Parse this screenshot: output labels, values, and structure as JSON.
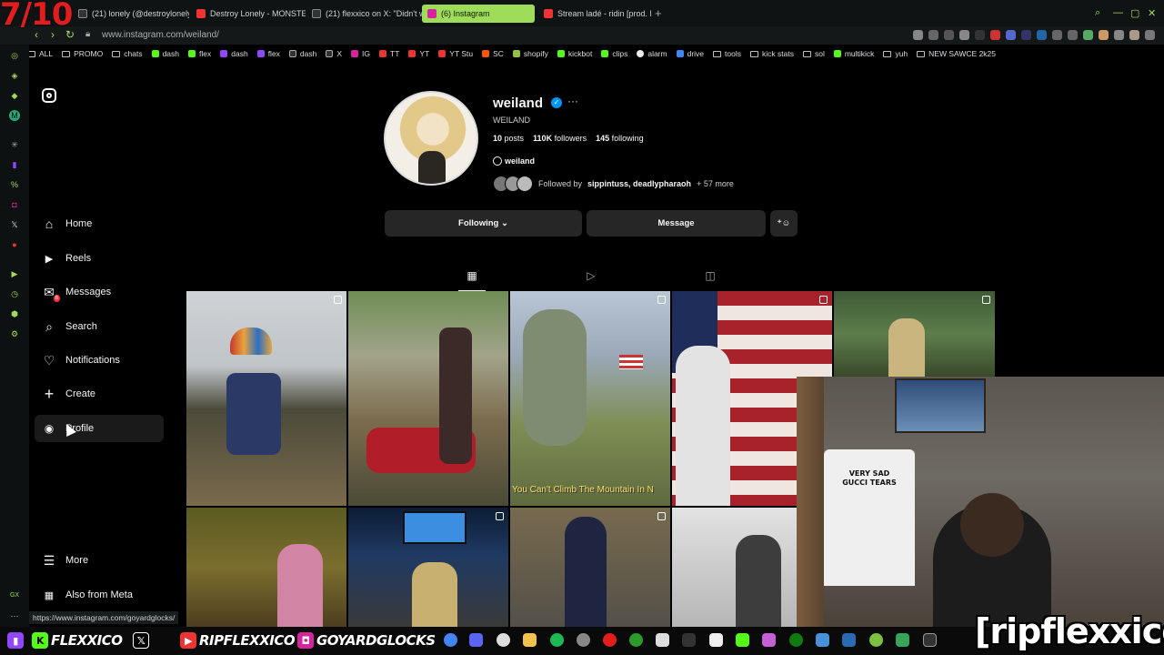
{
  "overlay": {
    "rating": "7/10",
    "watermark": "[ripflexxico]"
  },
  "browser": {
    "tabs": [
      {
        "label": "(21) lonely (@destroylonely",
        "color": "#444"
      },
      {
        "label": "Destroy Lonely - MONSTER",
        "color": "#e33"
      },
      {
        "label": "(21) flexxico on X: \"Didn't w",
        "color": "#444"
      },
      {
        "label": "(6) Instagram",
        "color": "#d6249f",
        "active": true
      },
      {
        "label": "Stream ladé - ridin [prod. h",
        "color": "#e33"
      }
    ],
    "url": "www.instagram.com/weiland/",
    "bookmarks": [
      "ALL",
      "PROMO",
      "chats",
      "dash",
      "flex",
      "dash",
      "flex",
      "dash",
      "X",
      "IG",
      "TT",
      "YT",
      "YT Stu",
      "SC",
      "shopify",
      "kickbot",
      "clips",
      "alarm",
      "drive",
      "tools",
      "kick stats",
      "sol",
      "multikick",
      "yuh",
      "NEW SAWCE 2k25"
    ],
    "status_url": "https://www.instagram.com/goyardglocks/"
  },
  "nav": {
    "items": [
      {
        "label": "Home",
        "icon": "home-icon",
        "glyph": "⌂"
      },
      {
        "label": "Reels",
        "icon": "reels-icon",
        "glyph": "▶"
      },
      {
        "label": "Messages",
        "icon": "messages-icon",
        "glyph": "✉",
        "badge": "6"
      },
      {
        "label": "Search",
        "icon": "search-icon",
        "glyph": "⌕"
      },
      {
        "label": "Notifications",
        "icon": "heart-icon",
        "glyph": "♡"
      },
      {
        "label": "Create",
        "icon": "plus-icon",
        "glyph": "+"
      },
      {
        "label": "Profile",
        "icon": "profile-icon",
        "glyph": "◉",
        "selected": true
      }
    ],
    "more": {
      "label": "More",
      "icon": "menu-icon"
    },
    "meta": {
      "label": "Also from Meta",
      "icon": "meta-icon"
    }
  },
  "profile": {
    "username": "weiland",
    "display_name": "WEILAND",
    "posts": "10",
    "posts_label": "posts",
    "followers": "110K",
    "followers_label": "followers",
    "following": "145",
    "following_label": "following",
    "threads": "weiland",
    "followed_by_prefix": "Followed by",
    "followed_by_names": "sippintuss, deadlypharaoh",
    "followed_by_more": "+ 57 more",
    "buttons": {
      "following": "Following ⌄",
      "message": "Message"
    }
  },
  "posts": [
    {
      "caption": ""
    },
    {
      "caption": ""
    },
    {
      "caption": "You Can't Climb The Mountain In N"
    },
    {
      "caption": ""
    },
    {
      "caption": ""
    },
    {
      "caption": ""
    },
    {
      "caption": ""
    },
    {
      "caption": ""
    },
    {
      "caption": ""
    }
  ],
  "webcam": {
    "shirt_text": "VERY SAD\nGUCCI TEARS"
  },
  "socials": [
    {
      "platform": "twitch",
      "handle": ""
    },
    {
      "platform": "kick",
      "handle": "FLEXXICO"
    },
    {
      "platform": "x",
      "handle": ""
    },
    {
      "platform": "youtube",
      "handle": "RIPFLEXXICO"
    },
    {
      "platform": "instagram",
      "handle": "GOYARDGLOCKS"
    }
  ],
  "colors": {
    "accent": "#9fdc5a",
    "instagram_blue": "#0095f6",
    "notification_red": "#ff3040"
  }
}
